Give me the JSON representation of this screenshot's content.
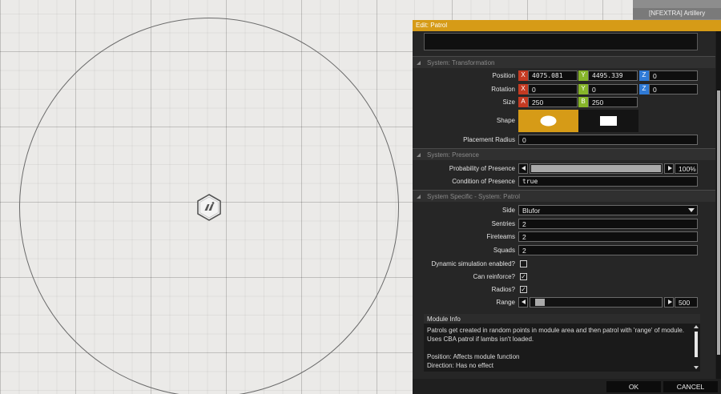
{
  "top_list": {
    "item_label": "[NFEXTRA] Artillery"
  },
  "dialog": {
    "title": "Edit: Patrol",
    "sections": {
      "transformation": "System: Transformation",
      "presence": "System: Presence",
      "patrol": "System Specific - System: Patrol"
    },
    "transformation": {
      "position_label": "Position",
      "position": {
        "x_axis": "X",
        "x": "4075.081",
        "y_axis": "Y",
        "y": "4495.339",
        "z_axis": "Z",
        "z": "0"
      },
      "rotation_label": "Rotation",
      "rotation": {
        "x_axis": "X",
        "x": "0",
        "y_axis": "Y",
        "y": "0",
        "z_axis": "Z",
        "z": "0"
      },
      "size_label": "Size",
      "size": {
        "a_axis": "A",
        "a": "250",
        "b_axis": "B",
        "b": "250"
      },
      "shape_label": "Shape",
      "shape_selected": "ellipse",
      "placement_radius_label": "Placement Radius",
      "placement_radius": "0"
    },
    "presence": {
      "probability_label": "Probability of Presence",
      "probability_value": "100%",
      "probability_fraction": 1.0,
      "condition_label": "Condition of Presence",
      "condition_value": "true"
    },
    "patrol": {
      "side_label": "Side",
      "side_value": "Blufor",
      "sentries_label": "Sentries",
      "sentries_value": "2",
      "fireteams_label": "Fireteams",
      "fireteams_value": "2",
      "squads_label": "Squads",
      "squads_value": "2",
      "dynamic_sim_label": "Dynamic simulation enabled?",
      "dynamic_sim_checked": false,
      "can_reinforce_label": "Can reinforce?",
      "can_reinforce_checked": true,
      "radios_label": "Radios?",
      "radios_checked": true,
      "range_label": "Range",
      "range_value": "500",
      "range_fraction": 0.03
    },
    "module_info": {
      "title": "Module Info",
      "text": "Patrols get created in random points in module area and then patrol with 'range' of module. Uses CBA patrol if lambs isn't loaded.\n\nPosition: Affects module function\nDirection: Has no effect"
    },
    "buttons": {
      "ok": "OK",
      "cancel": "CANCEL"
    }
  },
  "colors": {
    "title_bar": "#d69b17",
    "axis_red": "#c43a22",
    "axis_green": "#86b52a",
    "axis_blue": "#2f7ad6",
    "shape_selected": "#d69b17"
  },
  "icons": {
    "module": "patrol-module-icon",
    "shape_ellipse": "ellipse-shape-icon",
    "shape_rectangle": "rectangle-shape-icon"
  }
}
